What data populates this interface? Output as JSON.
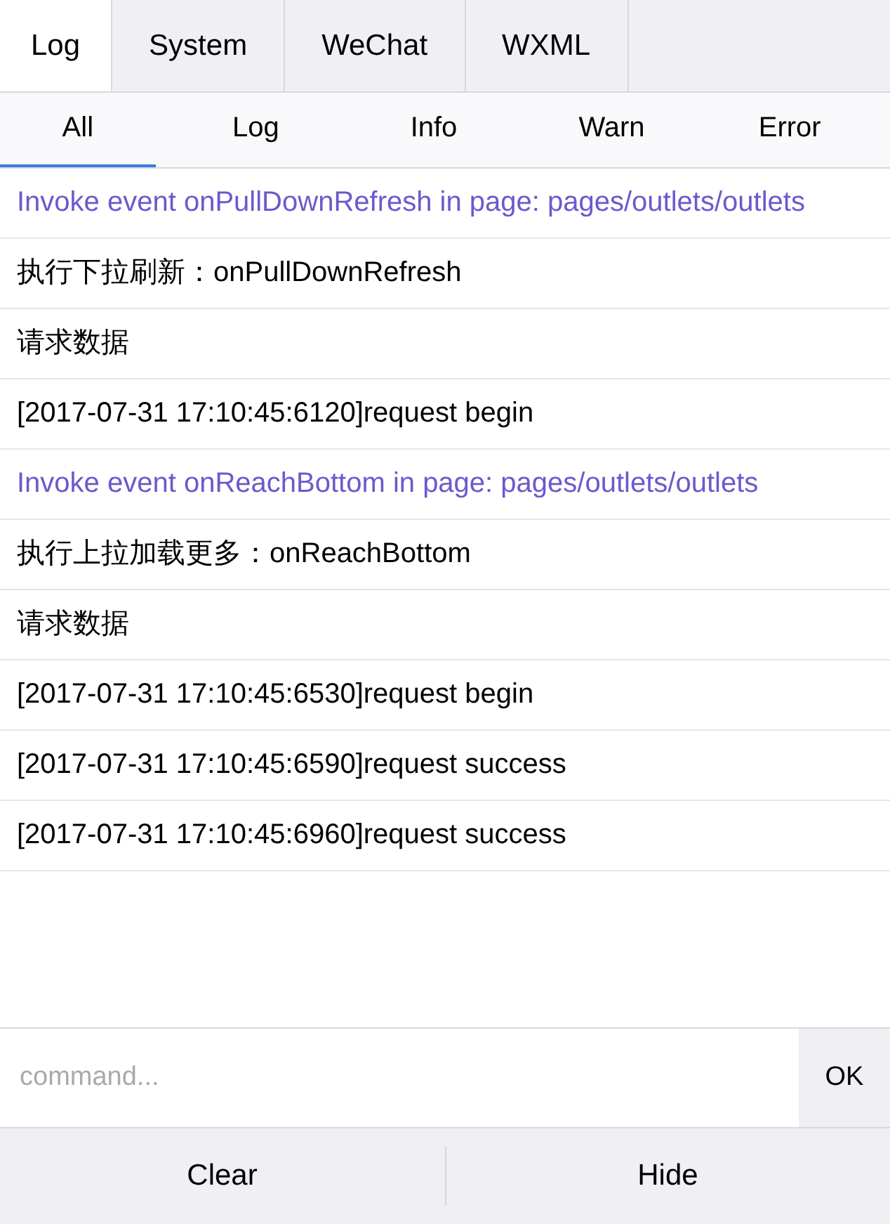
{
  "tabs": [
    {
      "label": "Log",
      "selected": true
    },
    {
      "label": "System",
      "selected": false
    },
    {
      "label": "WeChat",
      "selected": false
    },
    {
      "label": "WXML",
      "selected": false
    }
  ],
  "filters": [
    {
      "label": "All",
      "selected": true
    },
    {
      "label": "Log",
      "selected": false
    },
    {
      "label": "Info",
      "selected": false
    },
    {
      "label": "Warn",
      "selected": false
    },
    {
      "label": "Error",
      "selected": false
    }
  ],
  "logs": [
    {
      "kind": "info",
      "text": "Invoke event onPullDownRefresh in page: pages/outlets/outlets"
    },
    {
      "kind": "log",
      "text": "执行下拉刷新：onPullDownRefresh"
    },
    {
      "kind": "log",
      "text": "请求数据"
    },
    {
      "kind": "log",
      "text": "[2017-07-31 17:10:45:6120]request begin"
    },
    {
      "kind": "info",
      "text": "Invoke event onReachBottom in page: pages/outlets/outlets"
    },
    {
      "kind": "log",
      "text": "执行上拉加载更多：onReachBottom"
    },
    {
      "kind": "log",
      "text": "请求数据"
    },
    {
      "kind": "log",
      "text": "[2017-07-31 17:10:45:6530]request begin"
    },
    {
      "kind": "log",
      "text": "[2017-07-31 17:10:45:6590]request success"
    },
    {
      "kind": "log",
      "text": "[2017-07-31 17:10:45:6960]request success"
    }
  ],
  "command": {
    "placeholder": "command...",
    "button": "OK"
  },
  "footer": [
    "Clear",
    "Hide"
  ]
}
